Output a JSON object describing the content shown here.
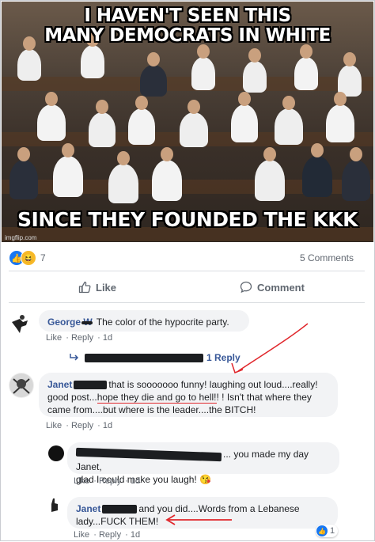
{
  "meme": {
    "caption_top_1": "I HAVEN'T SEEN THIS",
    "caption_top_2": "MANY DEMOCRATS IN WHITE",
    "caption_bottom": "SINCE THEY FOUNDED THE KKK",
    "watermark": "imgflip.com"
  },
  "post_stats": {
    "reaction_count": "7",
    "comments_count": "5 Comments"
  },
  "actions": {
    "like": "Like",
    "comment": "Comment"
  },
  "comments": [
    {
      "author": "George W",
      "text": "The color of the hypocrite party.",
      "like": "Like",
      "reply": "Reply",
      "time": "1d",
      "replies_link": "1 Reply"
    },
    {
      "author": "Janet",
      "text_1": "that is sooooooo funny! laughing out loud....really!",
      "text_2a": "good post...",
      "text_2b": "hope they die and go to hell!",
      "text_2c": "! ! Isn't that where they",
      "text_3": "came from....but where is the leader....the BITCH!",
      "like": "Like",
      "reply": "Reply",
      "time": "1d"
    },
    {
      "author": "",
      "text_1": "... you made my day Janet,",
      "text_2": "glad I could make you laugh!",
      "emoji": "😘",
      "like": "Like",
      "reply": "Reply",
      "time": "1d"
    },
    {
      "author": "Janet",
      "text_1": "and you did....Words from a Lebanese",
      "text_2": "lady...FUCK THEM!",
      "like": "Like",
      "reply": "Reply",
      "time": "1d",
      "reaction_count": "1"
    }
  ],
  "colors": {
    "link_blue": "#385898",
    "like_blue": "#1877f2",
    "annotation_red": "#e0262b"
  },
  "icons": [
    "like-reaction-icon",
    "haha-reaction-icon",
    "thumbs-up-icon",
    "comment-bubble-icon",
    "reply-arrow-icon"
  ]
}
